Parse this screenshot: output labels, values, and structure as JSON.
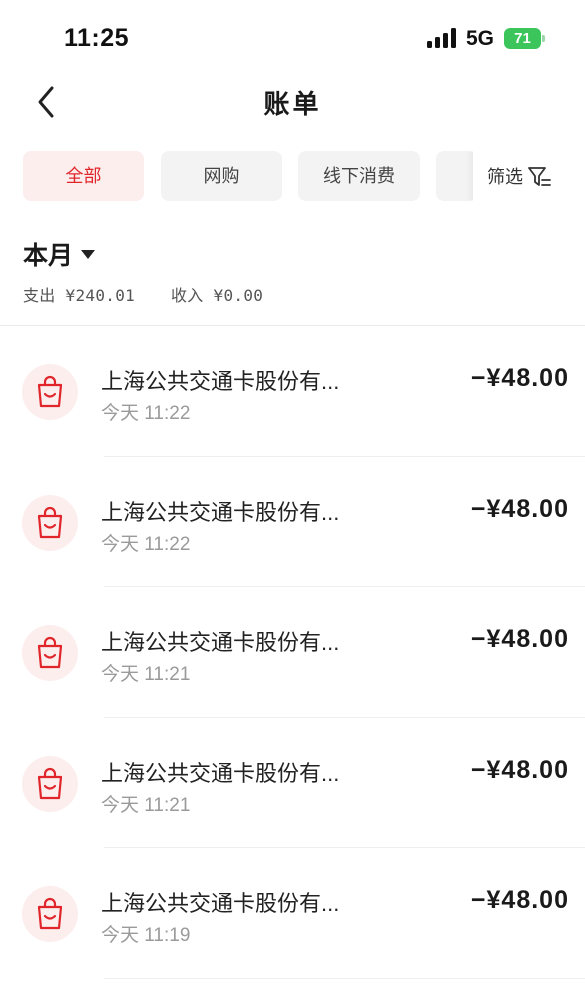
{
  "status_bar": {
    "time": "11:25",
    "network": "5G",
    "battery": "71"
  },
  "header": {
    "title": "账单"
  },
  "tabs": [
    {
      "label": "全部",
      "active": true
    },
    {
      "label": "网购",
      "active": false
    },
    {
      "label": "线下消费",
      "active": false
    }
  ],
  "filter": {
    "label": "筛选"
  },
  "period": {
    "label": "本月",
    "expense": "支出 ¥240.01",
    "income": "收入 ¥0.00"
  },
  "transactions": [
    {
      "merchant": "上海公共交通卡股份有...",
      "time": "今天 11:22",
      "amount": "−¥48.00"
    },
    {
      "merchant": "上海公共交通卡股份有...",
      "time": "今天 11:22",
      "amount": "−¥48.00"
    },
    {
      "merchant": "上海公共交通卡股份有...",
      "time": "今天 11:21",
      "amount": "−¥48.00"
    },
    {
      "merchant": "上海公共交通卡股份有...",
      "time": "今天 11:21",
      "amount": "−¥48.00"
    },
    {
      "merchant": "上海公共交通卡股份有...",
      "time": "今天 11:19",
      "amount": "−¥48.00"
    }
  ],
  "colors": {
    "accent": "#e0262b",
    "accent_bg": "#fdeeee",
    "battery": "#3bc55a"
  },
  "icons": {
    "back": "chevron-left-icon",
    "filter": "filter-icon",
    "merchant": "shopping-bag-icon",
    "signal": "cellular-signal-icon"
  }
}
